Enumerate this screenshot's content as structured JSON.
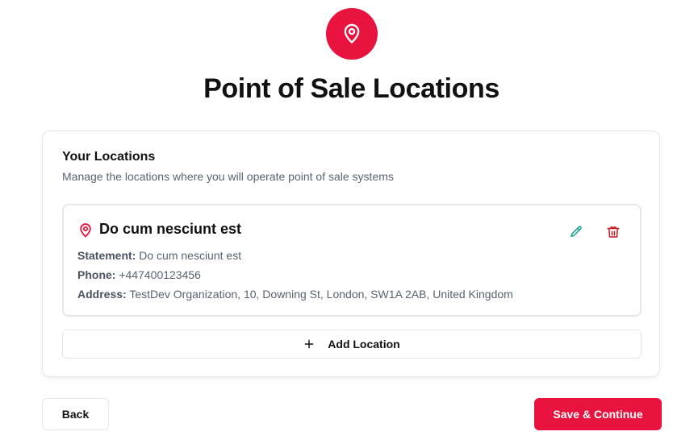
{
  "page": {
    "title": "Point of Sale Locations",
    "icon": "map-pin-icon",
    "accent_color": "#e8133f"
  },
  "card": {
    "title": "Your Locations",
    "subtitle": "Manage the locations where you will operate point of sale systems"
  },
  "locations": [
    {
      "name": "Do cum nesciunt est",
      "statement_label": "Statement:",
      "statement": "Do cum nesciunt est",
      "phone_label": "Phone:",
      "phone": "+447400123456",
      "address_label": "Address:",
      "address": "TestDev Organization, 10, Downing St, London, SW1A 2AB, United Kingdom",
      "edit_icon": "pencil-icon",
      "edit_color": "#0f9d8a",
      "delete_icon": "trash-icon",
      "delete_color": "#c4161c"
    }
  ],
  "actions": {
    "add_location_label": "Add Location",
    "back_label": "Back",
    "save_label": "Save & Continue"
  }
}
